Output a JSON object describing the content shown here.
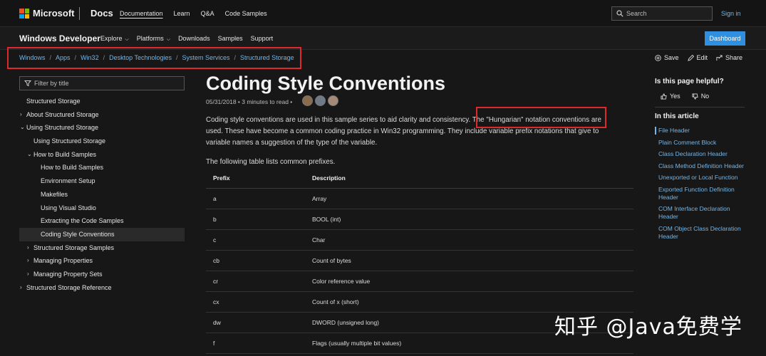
{
  "topbar": {
    "brand": "Microsoft",
    "docs": "Docs",
    "nav": [
      "Documentation",
      "Learn",
      "Q&A",
      "Code Samples"
    ],
    "search_placeholder": "Search",
    "signin": "Sign in",
    "logo_colors": [
      "#f25022",
      "#7fba00",
      "#00a4ef",
      "#ffb900"
    ]
  },
  "devbar": {
    "title": "Windows Developer",
    "nav": [
      "Explore",
      "Platforms",
      "Downloads",
      "Samples",
      "Support"
    ],
    "dashboard": "Dashboard"
  },
  "breadcrumb": [
    "Windows",
    "Apps",
    "Win32",
    "Desktop Technologies",
    "System Services",
    "Structured Storage"
  ],
  "actions": {
    "save": "Save",
    "edit": "Edit",
    "share": "Share"
  },
  "sidebar": {
    "filter_placeholder": "Filter by title",
    "items": [
      "Structured Storage",
      "About Structured Storage",
      "Using Structured Storage",
      "Using Structured Storage",
      "How to Build Samples",
      "How to Build Samples",
      "Environment Setup",
      "Makefiles",
      "Using Visual Studio",
      "Extracting the Code Samples",
      "Coding Style Conventions",
      "Structured Storage Samples",
      "Managing Properties",
      "Managing Property Sets",
      "Structured Storage Reference"
    ]
  },
  "main": {
    "title": "Coding Style Conventions",
    "meta": "05/31/2018 • 3 minutes to read •",
    "para1": "Coding style conventions are used in this sample series to aid clarity and consistency.",
    "para_highlight": "The \"Hungarian\" notation conventions",
    "para2": "are used. These have become a common coding practice in Win32 programming. They include variable prefix notations that give to variable names a suggestion of the type of the variable.",
    "table_lead": "The following table lists common prefixes.",
    "table": {
      "headers": [
        "Prefix",
        "Description"
      ],
      "rows": [
        [
          "a",
          "Array"
        ],
        [
          "b",
          "BOOL (int)"
        ],
        [
          "c",
          "Char"
        ],
        [
          "cb",
          "Count of bytes"
        ],
        [
          "cr",
          "Color reference value"
        ],
        [
          "cx",
          "Count of x (short)"
        ],
        [
          "dw",
          "DWORD (unsigned long)"
        ],
        [
          "f",
          "Flags (usually multiple bit values)"
        ]
      ]
    }
  },
  "rail": {
    "helpful": "Is this page helpful?",
    "yes": "Yes",
    "no": "No",
    "in_article": "In this article",
    "links": [
      "File Header",
      "Plain Comment Block",
      "Class Declaration Header",
      "Class Method Definition Header",
      "Unexported or Local Function",
      "Exported Function Definition Header",
      "COM Interface Declaration Header",
      "COM Object Class Declaration Header"
    ]
  },
  "watermark": "知乎 @Java免费学",
  "colors": {
    "accent": "#75b6e7",
    "highlight_box": "#e0282e",
    "button": "#2f8fe0"
  }
}
